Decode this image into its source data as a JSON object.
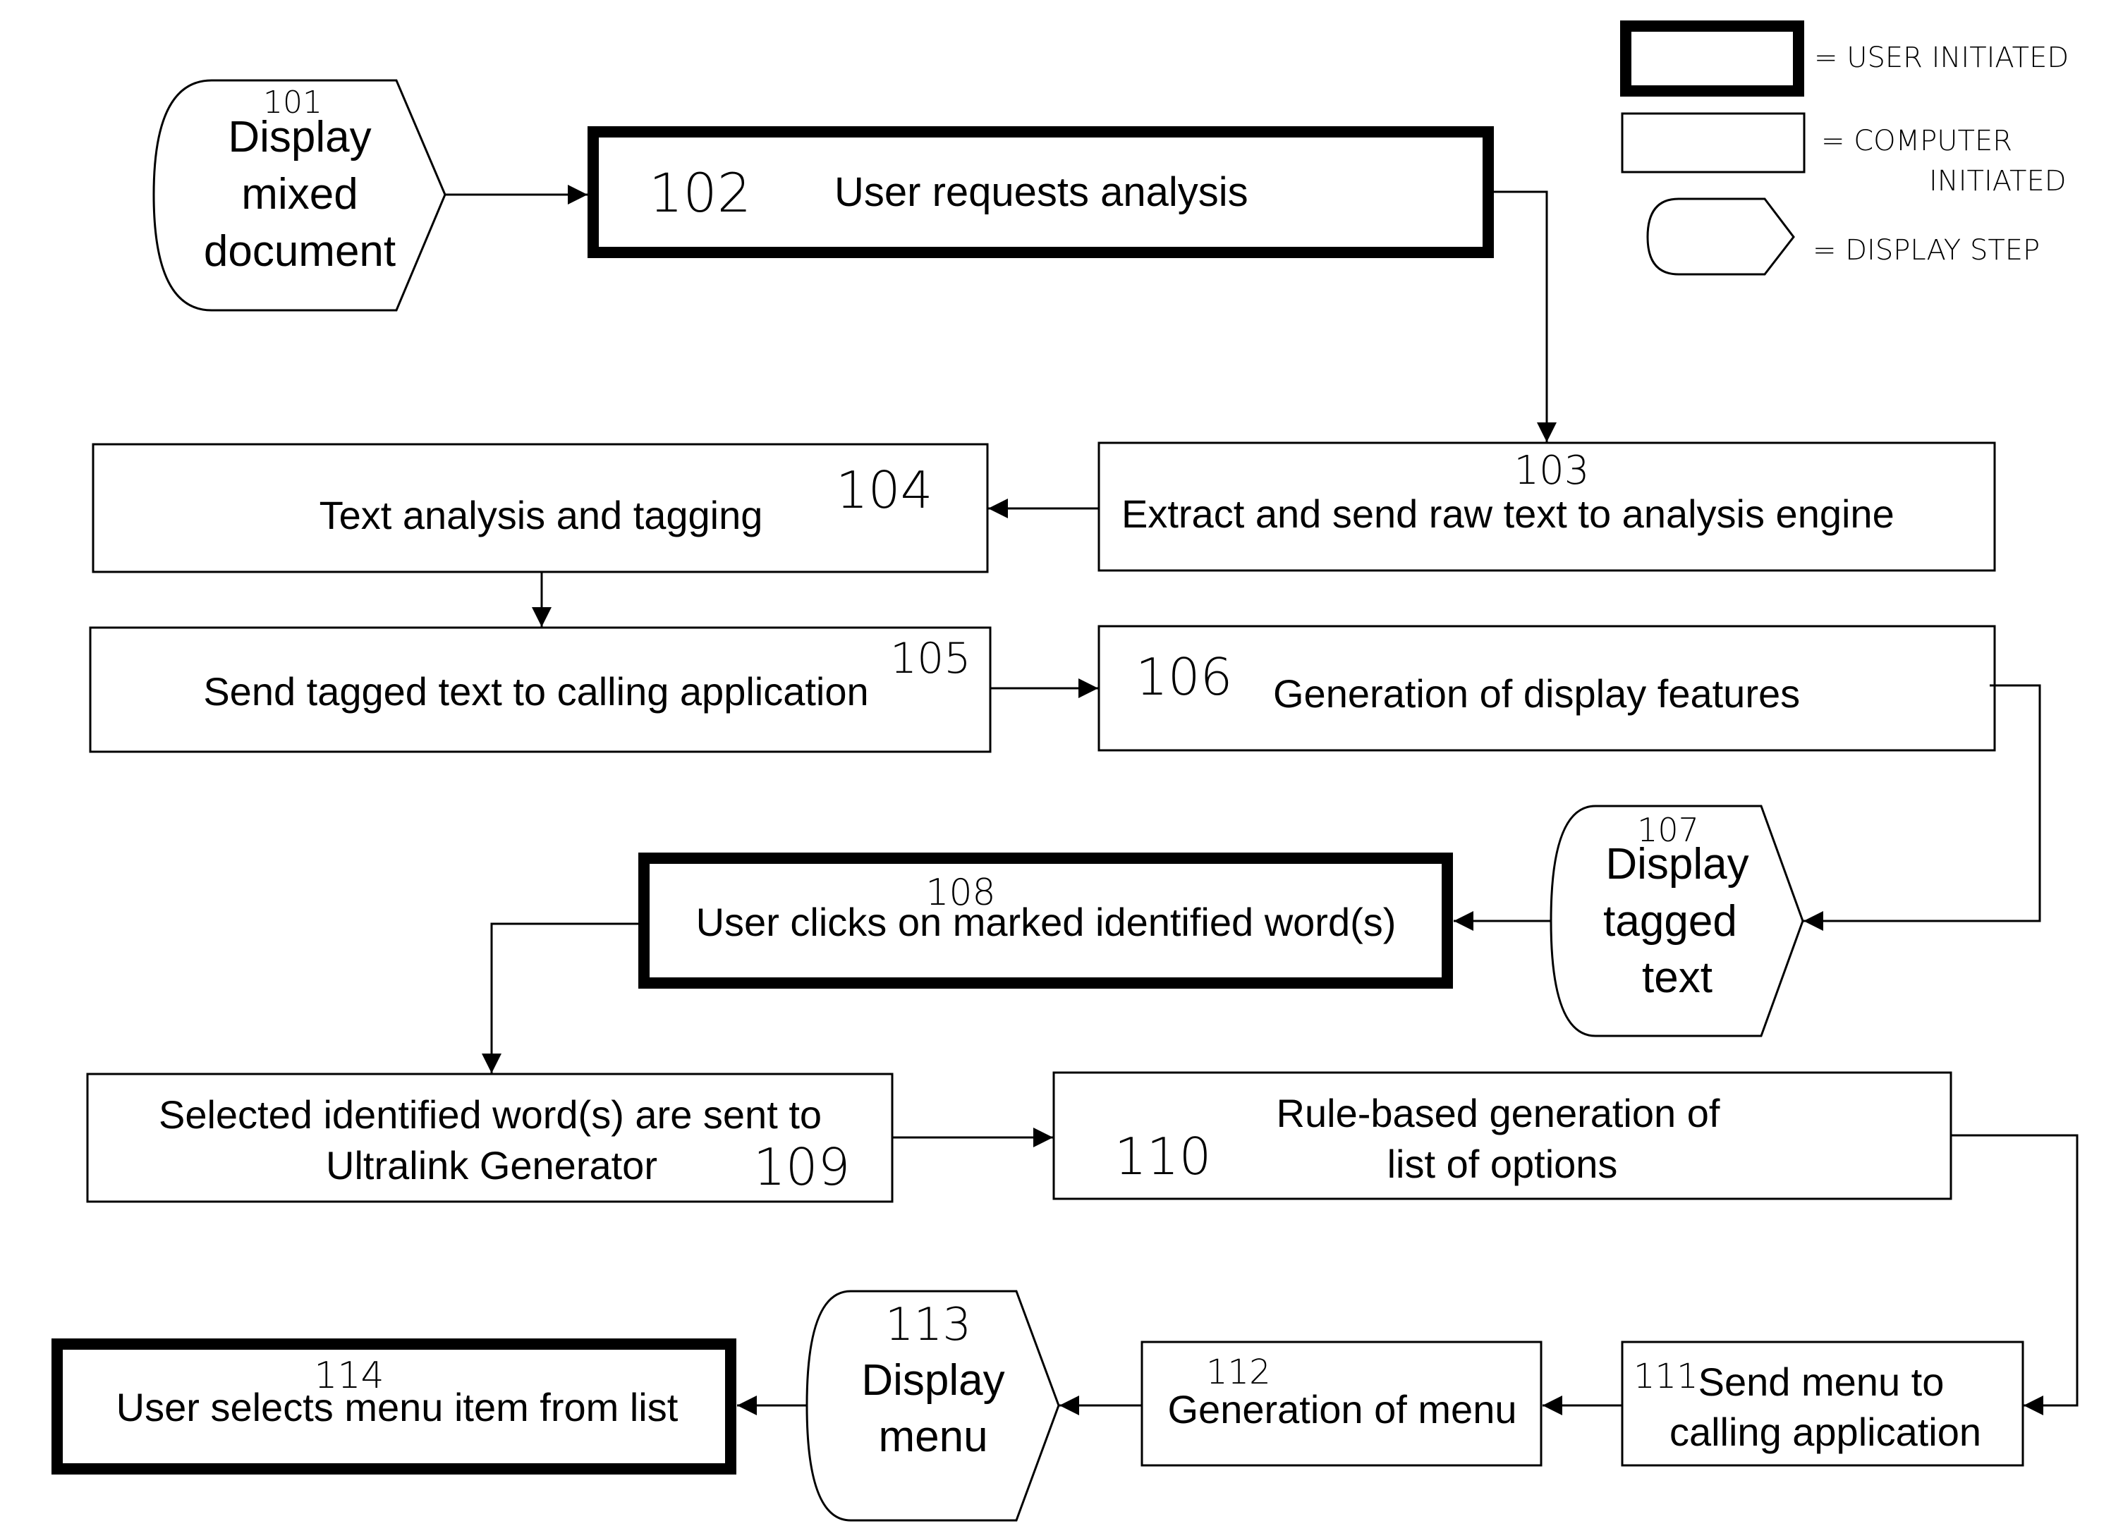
{
  "legend": {
    "user_initiated": "= USER INITIATED",
    "computer_initiated_line1": "= COMPUTER",
    "computer_initiated_line2": "INITIATED",
    "display_step": "= DISPLAY STEP"
  },
  "steps": {
    "s101": {
      "number": "101",
      "type": "display",
      "lines": [
        "Display",
        "mixed",
        "document"
      ]
    },
    "s102": {
      "number": "102",
      "type": "user",
      "lines": [
        "User requests analysis"
      ]
    },
    "s103": {
      "number": "103",
      "type": "computer",
      "lines": [
        "Extract and send raw text to analysis engine"
      ]
    },
    "s104": {
      "number": "104",
      "type": "computer",
      "lines": [
        "Text analysis and tagging"
      ]
    },
    "s105": {
      "number": "105",
      "type": "computer",
      "lines": [
        "Send tagged text to calling application"
      ]
    },
    "s106": {
      "number": "106",
      "type": "computer",
      "lines": [
        "Generation of display features"
      ]
    },
    "s107": {
      "number": "107",
      "type": "display",
      "lines": [
        "Display",
        "tagged",
        "text"
      ]
    },
    "s108": {
      "number": "108",
      "type": "user",
      "lines": [
        "User clicks on marked identified word(s)"
      ]
    },
    "s109": {
      "number": "109",
      "type": "computer",
      "lines": [
        "Selected identified word(s) are sent to",
        "Ultralink Generator"
      ]
    },
    "s110": {
      "number": "110",
      "type": "computer",
      "lines": [
        "Rule-based generation of",
        "list of options"
      ]
    },
    "s111": {
      "number": "111",
      "type": "computer",
      "lines": [
        "Send menu to",
        "calling application"
      ]
    },
    "s112": {
      "number": "112",
      "type": "computer",
      "lines": [
        "Generation of menu"
      ]
    },
    "s113": {
      "number": "113",
      "type": "display",
      "lines": [
        "Display",
        "menu"
      ]
    },
    "s114": {
      "number": "114",
      "type": "user",
      "lines": [
        "User selects menu item from list"
      ]
    }
  },
  "flow": [
    [
      "101",
      "102"
    ],
    [
      "102",
      "103"
    ],
    [
      "103",
      "104"
    ],
    [
      "104",
      "105"
    ],
    [
      "105",
      "106"
    ],
    [
      "106",
      "107"
    ],
    [
      "107",
      "108"
    ],
    [
      "108",
      "109"
    ],
    [
      "109",
      "110"
    ],
    [
      "110",
      "111"
    ],
    [
      "111",
      "112"
    ],
    [
      "112",
      "113"
    ],
    [
      "113",
      "114"
    ]
  ]
}
